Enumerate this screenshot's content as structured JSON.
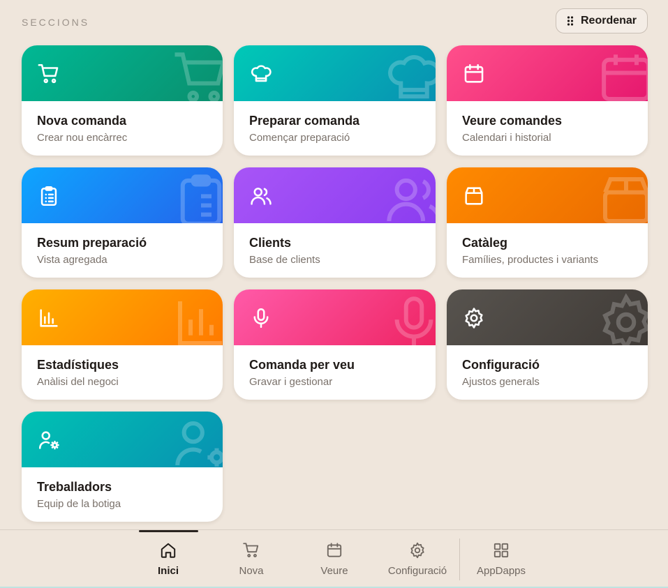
{
  "header": {
    "section_title": "SECCIONS",
    "reorder_label": "Reordenar"
  },
  "cards": [
    {
      "title": "Nova comanda",
      "subtitle": "Crear nou encàrrec",
      "icon": "cart-icon",
      "gradient": [
        "#00b894",
        "#0a8f6e"
      ]
    },
    {
      "title": "Preparar comanda",
      "subtitle": "Començar preparació",
      "icon": "chef-hat-icon",
      "gradient": [
        "#00c9b7",
        "#0891b2"
      ]
    },
    {
      "title": "Veure comandes",
      "subtitle": "Calendari i historial",
      "icon": "calendar-icon",
      "gradient": [
        "#ff4f8b",
        "#e6186e"
      ]
    },
    {
      "title": "Resum preparació",
      "subtitle": "Vista agregada",
      "icon": "clipboard-list-icon",
      "gradient": [
        "#0ea5ff",
        "#2563eb"
      ]
    },
    {
      "title": "Clients",
      "subtitle": "Base de clients",
      "icon": "users-icon",
      "gradient": [
        "#a855f7",
        "#8b3df0"
      ]
    },
    {
      "title": "Catàleg",
      "subtitle": "Famílies, productes i variants",
      "icon": "box-icon",
      "gradient": [
        "#ff8a00",
        "#ea6a00"
      ]
    },
    {
      "title": "Estadístiques",
      "subtitle": "Anàlisi del negoci",
      "icon": "bar-chart-icon",
      "gradient": [
        "#ffb000",
        "#ff7a00"
      ]
    },
    {
      "title": "Comanda per veu",
      "subtitle": "Gravar i gestionar",
      "icon": "microphone-icon",
      "gradient": [
        "#ff5aa8",
        "#ee2463"
      ]
    },
    {
      "title": "Configuració",
      "subtitle": "Ajustos generals",
      "icon": "gear-icon",
      "gradient": [
        "#57534e",
        "#3f3a36"
      ]
    },
    {
      "title": "Treballadors",
      "subtitle": "Equip de la botiga",
      "icon": "user-gear-icon",
      "gradient": [
        "#00c2b3",
        "#0891b2"
      ]
    }
  ],
  "nav": {
    "items": [
      {
        "label": "Inici",
        "icon": "home-icon",
        "active": true
      },
      {
        "label": "Nova",
        "icon": "cart-icon",
        "active": false
      },
      {
        "label": "Veure",
        "icon": "calendar-icon",
        "active": false
      },
      {
        "label": "Configuració",
        "icon": "gear-icon",
        "active": false
      },
      {
        "label": "AppDapps",
        "icon": "grid-icon",
        "active": false
      }
    ]
  }
}
